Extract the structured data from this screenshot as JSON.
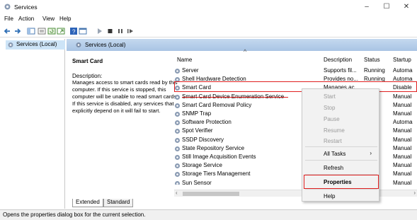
{
  "window": {
    "title": "Services",
    "minimize": "–",
    "maximize": "☐",
    "close": "✕"
  },
  "menu": [
    "File",
    "Action",
    "View",
    "Help"
  ],
  "toolbar_icons": [
    "back-icon",
    "forward-icon",
    "console-tree-icon",
    "properties-list-icon",
    "refresh-icon",
    "export-icon",
    "help-icon",
    "view-icon",
    "play-icon",
    "stop-icon",
    "pause-icon",
    "restart-icon"
  ],
  "tree": {
    "root": "Services (Local)"
  },
  "pane": {
    "header": "Services (Local)",
    "selected_service": "Smart Card",
    "description_label": "Description:",
    "description_text": "Manages access to smart cards read by this computer. If this service is stopped, this computer will be unable to read smart cards. If this service is disabled, any services that explicitly depend on it will fail to start."
  },
  "table": {
    "columns": [
      "Name",
      "Description",
      "Status",
      "Startup"
    ],
    "rows": [
      {
        "name": "Server",
        "description": "Supports fil...",
        "status": "Running",
        "startup": "Automa"
      },
      {
        "name": "Shell Hardware Detection",
        "description": "Provides no...",
        "status": "Running",
        "startup": "Automa"
      },
      {
        "name": "Smart Card",
        "description": "Manages ac...",
        "status": "",
        "startup": "Disable"
      },
      {
        "name": "Smart Card Device Enumeration Service",
        "description": "",
        "status": "",
        "startup": "Manual"
      },
      {
        "name": "Smart Card Removal Policy",
        "description": "",
        "status": "",
        "startup": "Manual"
      },
      {
        "name": "SNMP Trap",
        "description": "",
        "status": "",
        "startup": "Manual"
      },
      {
        "name": "Software Protection",
        "description": "",
        "status": "",
        "startup": "Automa"
      },
      {
        "name": "Spot Verifier",
        "description": "",
        "status": "",
        "startup": "Manual"
      },
      {
        "name": "SSDP Discovery",
        "description": "",
        "status": "ng",
        "startup": "Manual"
      },
      {
        "name": "State Repository Service",
        "description": "",
        "status": "ng",
        "startup": "Manual"
      },
      {
        "name": "Still Image Acquisition Events",
        "description": "",
        "status": "",
        "startup": "Manual"
      },
      {
        "name": "Storage Service",
        "description": "",
        "status": "",
        "startup": "Manual"
      },
      {
        "name": "Storage Tiers Management",
        "description": "",
        "status": "",
        "startup": "Manual"
      },
      {
        "name": "Sun Sensor",
        "description": "",
        "status": "",
        "startup": "Manual"
      }
    ]
  },
  "tabs": [
    "Extended",
    "Standard"
  ],
  "context_menu": {
    "start": "Start",
    "stop": "Stop",
    "pause": "Pause",
    "resume": "Resume",
    "restart": "Restart",
    "all_tasks": "All Tasks",
    "all_tasks_arrow": "›",
    "refresh": "Refresh",
    "properties": "Properties",
    "help": "Help"
  },
  "status_bar": "Opens the properties dialog box for the current selection.",
  "colors": {
    "highlight_box": "#e02020",
    "header_blue": "#c4d9ef",
    "tree_selected": "#cde4f7"
  }
}
